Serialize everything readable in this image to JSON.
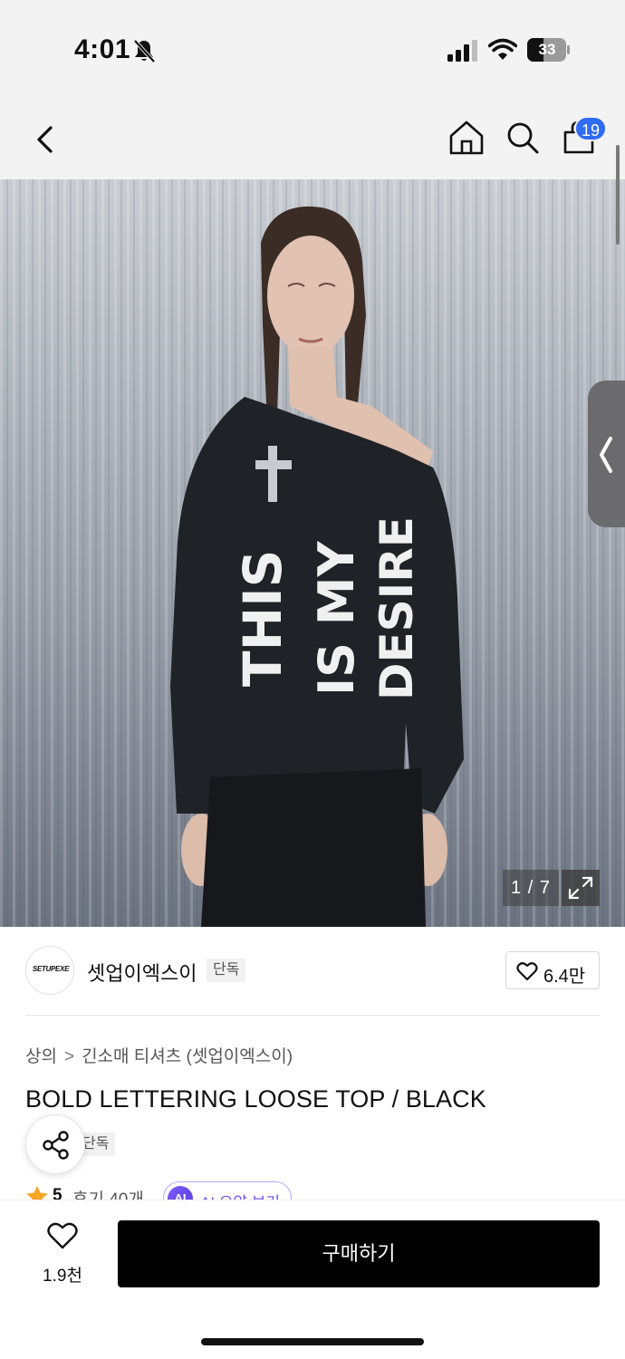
{
  "status": {
    "time": "4:01",
    "battery": "33",
    "icons": [
      "bell-off-icon",
      "signal-icon",
      "wifi-icon",
      "battery-icon"
    ]
  },
  "nav": {
    "cart_count": "19",
    "icons": [
      "back-icon",
      "home-icon",
      "search-icon",
      "cart-icon"
    ]
  },
  "gallery": {
    "counter": "1 / 7",
    "shirt_text": [
      "THIS",
      "IS MY",
      "DESIRE"
    ],
    "icons": [
      "chevron-left-icon",
      "expand-icon"
    ]
  },
  "brand": {
    "logo_text": "SETUPEXE",
    "name": "셋업이엑스이",
    "tag": "단독",
    "likes": "6.4만"
  },
  "product": {
    "breadcrumb": [
      "상의",
      "긴소매 티셔츠 (셋업이엑스이)"
    ],
    "title": "BOLD LETTERING LOOSE TOP / BLACK",
    "tag": "단독",
    "rating": "5",
    "reviews": "후기 40개",
    "ai_icon": "AI",
    "ai_label": "AI 요약 보기"
  },
  "bottom": {
    "wish_count": "1.9천",
    "buy_label": "구매하기"
  },
  "colors": {
    "accent_blue": "#2f6bf3",
    "ai_purple": "#6a4cf0",
    "star": "#f5a623",
    "buy_button": "#000000"
  }
}
